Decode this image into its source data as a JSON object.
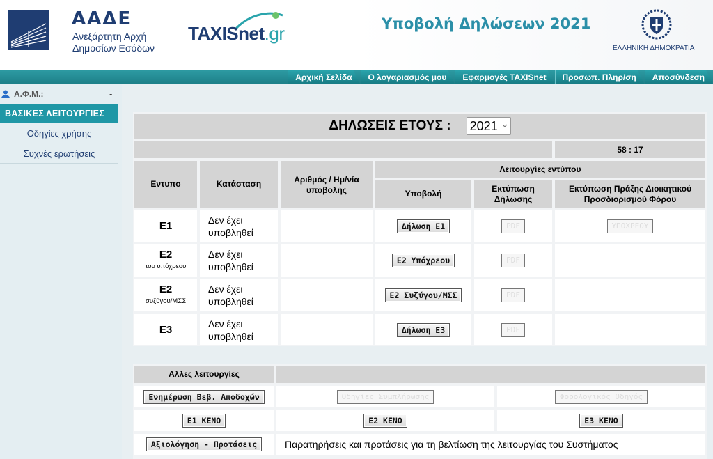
{
  "header": {
    "org_short": "ΑΑΔΕ",
    "org_line1": "Ανεξάρτητη Αρχή",
    "org_line2": "Δημοσίων Εσόδων",
    "taxisnet": "TAXISnet",
    "taxisnet_gr": ".gr",
    "title": "Υποβολή Δηλώσεων 2021",
    "republic": "ΕΛΛΗΝΙΚΗ ΔΗΜΟΚΡΑΤΙΑ"
  },
  "nav": {
    "items": [
      "Αρχική Σελίδα",
      "Ο λογαριασμός μου",
      "Εφαρμογές TAXISnet",
      "Προσωπ. Πληρ/ση",
      "Αποσύνδεση"
    ]
  },
  "sidebar": {
    "afm_label": "Α.Φ.Μ.:",
    "afm_value": "-",
    "section": "ΒΑΣΙΚΕΣ ΛΕΙΤΟΥΡΓΙΕΣ",
    "links": [
      "Οδηγίες χρήσης",
      "Συχνές ερωτήσεις"
    ]
  },
  "declarations": {
    "heading": "ΔΗΛΩΣΕΙΣ ΕΤΟΥΣ :",
    "year": "2021",
    "timer": "58 : 17",
    "columns": {
      "form": "Εντυπο",
      "status": "Κατάσταση",
      "number": "Αριθμός / Ημ/νία υποβολής",
      "functions": "Λειτουργίες εντύπου",
      "submit": "Υποβολή",
      "print": "Εκτύπωση Δήλωσης",
      "print_act": "Εκτύπωση Πράξης Διοικητικού Προσδιορισμού Φόρου"
    },
    "rows": [
      {
        "code": "Ε1",
        "sub": "",
        "status": "Δεν έχει υποβληθεί",
        "number": "",
        "submit": "Δήλωση Ε1",
        "print": "PDF",
        "act": "ΥΠΟΧΡΕΟΥ"
      },
      {
        "code": "Ε2",
        "sub": "του υπόχρεου",
        "status": "Δεν έχει υποβληθεί",
        "number": "",
        "submit": "Ε2 Υπόχρεου",
        "print": "PDF",
        "act": ""
      },
      {
        "code": "Ε2",
        "sub": "συζύγου/ΜΣΣ",
        "status": "Δεν έχει υποβληθεί",
        "number": "",
        "submit": "Ε2 Συζύγου/ΜΣΣ",
        "print": "PDF",
        "act": ""
      },
      {
        "code": "Ε3",
        "sub": "",
        "status": "Δεν έχει υποβληθεί",
        "number": "",
        "submit": "Δήλωση Ε3",
        "print": "PDF",
        "act": ""
      }
    ]
  },
  "other": {
    "heading": "Αλλες λειτουργίες",
    "update_btn": "Ενημέρωση Βεβ. Αποδοχών",
    "guide_btn": "Οδηγίες Συμπλήρωσης",
    "tax_guide_btn": "Φορολογικός Οδηγός",
    "e1_blank": "Ε1 ΚΕΝΟ",
    "e2_blank": "Ε2 ΚΕΝΟ",
    "e3_blank": "Ε3 ΚΕΝΟ",
    "eval_btn": "Αξιολόγηση - Προτάσεις",
    "eval_text": "Παρατηρήσεις και προτάσεις για τη βελτίωση της λειτουργίας του Συστήματος"
  },
  "colors": {
    "accent": "#1f97a6",
    "nav": "#2d9aa2",
    "brand": "#1f3d72",
    "title": "#2b8fa8"
  }
}
